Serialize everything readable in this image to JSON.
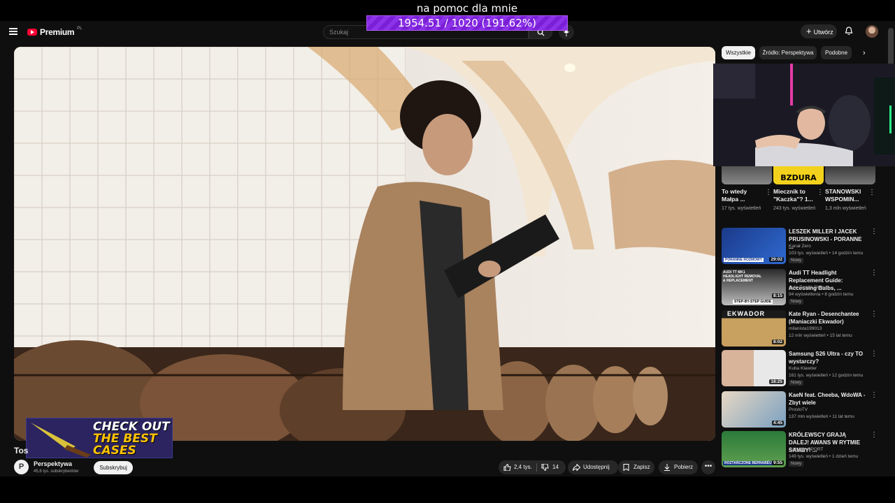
{
  "overlay": {
    "title": "na pomoc dla mnie",
    "goal": "1954.51 / 1020 (191.62%)",
    "goal_progress_percent": 191.62
  },
  "header": {
    "logo_text": "Premium",
    "logo_country": "PL",
    "search_placeholder": "Szukaj",
    "create_label": "Utwórz"
  },
  "video": {
    "title": "Tos",
    "channel_name": "Perspektywa",
    "channel_initial": "P",
    "channel_subscribers": "45,6 tys. subskrybentów",
    "subscribe_label": "Subskrybuj",
    "likes": "2,4 tys.",
    "dislikes": "14",
    "share_label": "Udostępnij",
    "save_label": "Zapisz",
    "download_label": "Pobierz"
  },
  "promo": {
    "line1": "CHECK OUT",
    "line2": "THE BEST",
    "line3": "CASES"
  },
  "sidebar": {
    "chips": [
      "Wszystkie",
      "Źródło: Perspektywa",
      "Podobne"
    ],
    "webcam_caption": "BZDURA",
    "shorts": [
      {
        "title": "To wtedy Małpa ...",
        "views": "17 tys. wyświetleń"
      },
      {
        "title": "Miecznik to \"Kaczka\"? 1...",
        "views": "243 tys. wyświetleń"
      },
      {
        "title": "STANOWSKI WSPOMIN...",
        "views": "1,3 mln wyświetleń"
      }
    ],
    "recommendations": [
      {
        "title": "LESZEK MILLER I JACEK PRUSINOWSKI - PORANNE ...",
        "channel": "Kanał Zero",
        "meta": "103 tys. wyświetleń • 14 godzin temu",
        "badge": "Nowy",
        "duration": "29:02",
        "thumb_caption": "PORANNE ROZMOWY"
      },
      {
        "title": "Audi TT Headlight Replacement Guide: Accessing Bulbs, ...",
        "channel": "Auto Repair Guys",
        "meta": "94 wyświetlenia • 8 godzin temu",
        "badge": "Nowy",
        "duration": "8:15",
        "thumb_caption": "AUDI TT MK1 HEADLIGHT REMOVAL & REPLACEMENT",
        "thumb_caption2": "STEP-BY-STEP GUIDE"
      },
      {
        "title": "Kate Ryan - Desenchantee (Maniaczki Ekwador)",
        "channel": "milanista199013",
        "meta": "12 mln wyświetleń • 15 lat temu",
        "badge": "",
        "duration": "8:02",
        "thumb_caption": "EKWADOR"
      },
      {
        "title": "Samsung S26 Ultra - czy TO wystarczy?",
        "channel": "Kuba Klawiter",
        "meta": "161 tys. wyświetleń • 12 godzin temu",
        "badge": "Nowy",
        "duration": "18:25",
        "thumb_caption": ""
      },
      {
        "title": "KaeN feat. Cheeba, WdoWA - Zbyt wiele",
        "channel": "ProstoTV",
        "meta": "137 mln wyświetleń • 11 lat temu",
        "badge": "",
        "duration": "4:45",
        "thumb_caption": ""
      },
      {
        "title": "KRÓLEWSCY GRAJĄ DALEJ! AWANS W RYTMIE SAMBY! ...",
        "channel": "CANAL+ SPORT",
        "meta": "149 tys. wyświetleń • 1 dzień temu",
        "badge": "Nowy",
        "duration": "9:55",
        "thumb_caption": "ROZTAŃCZONE BERNABÉU"
      }
    ]
  }
}
